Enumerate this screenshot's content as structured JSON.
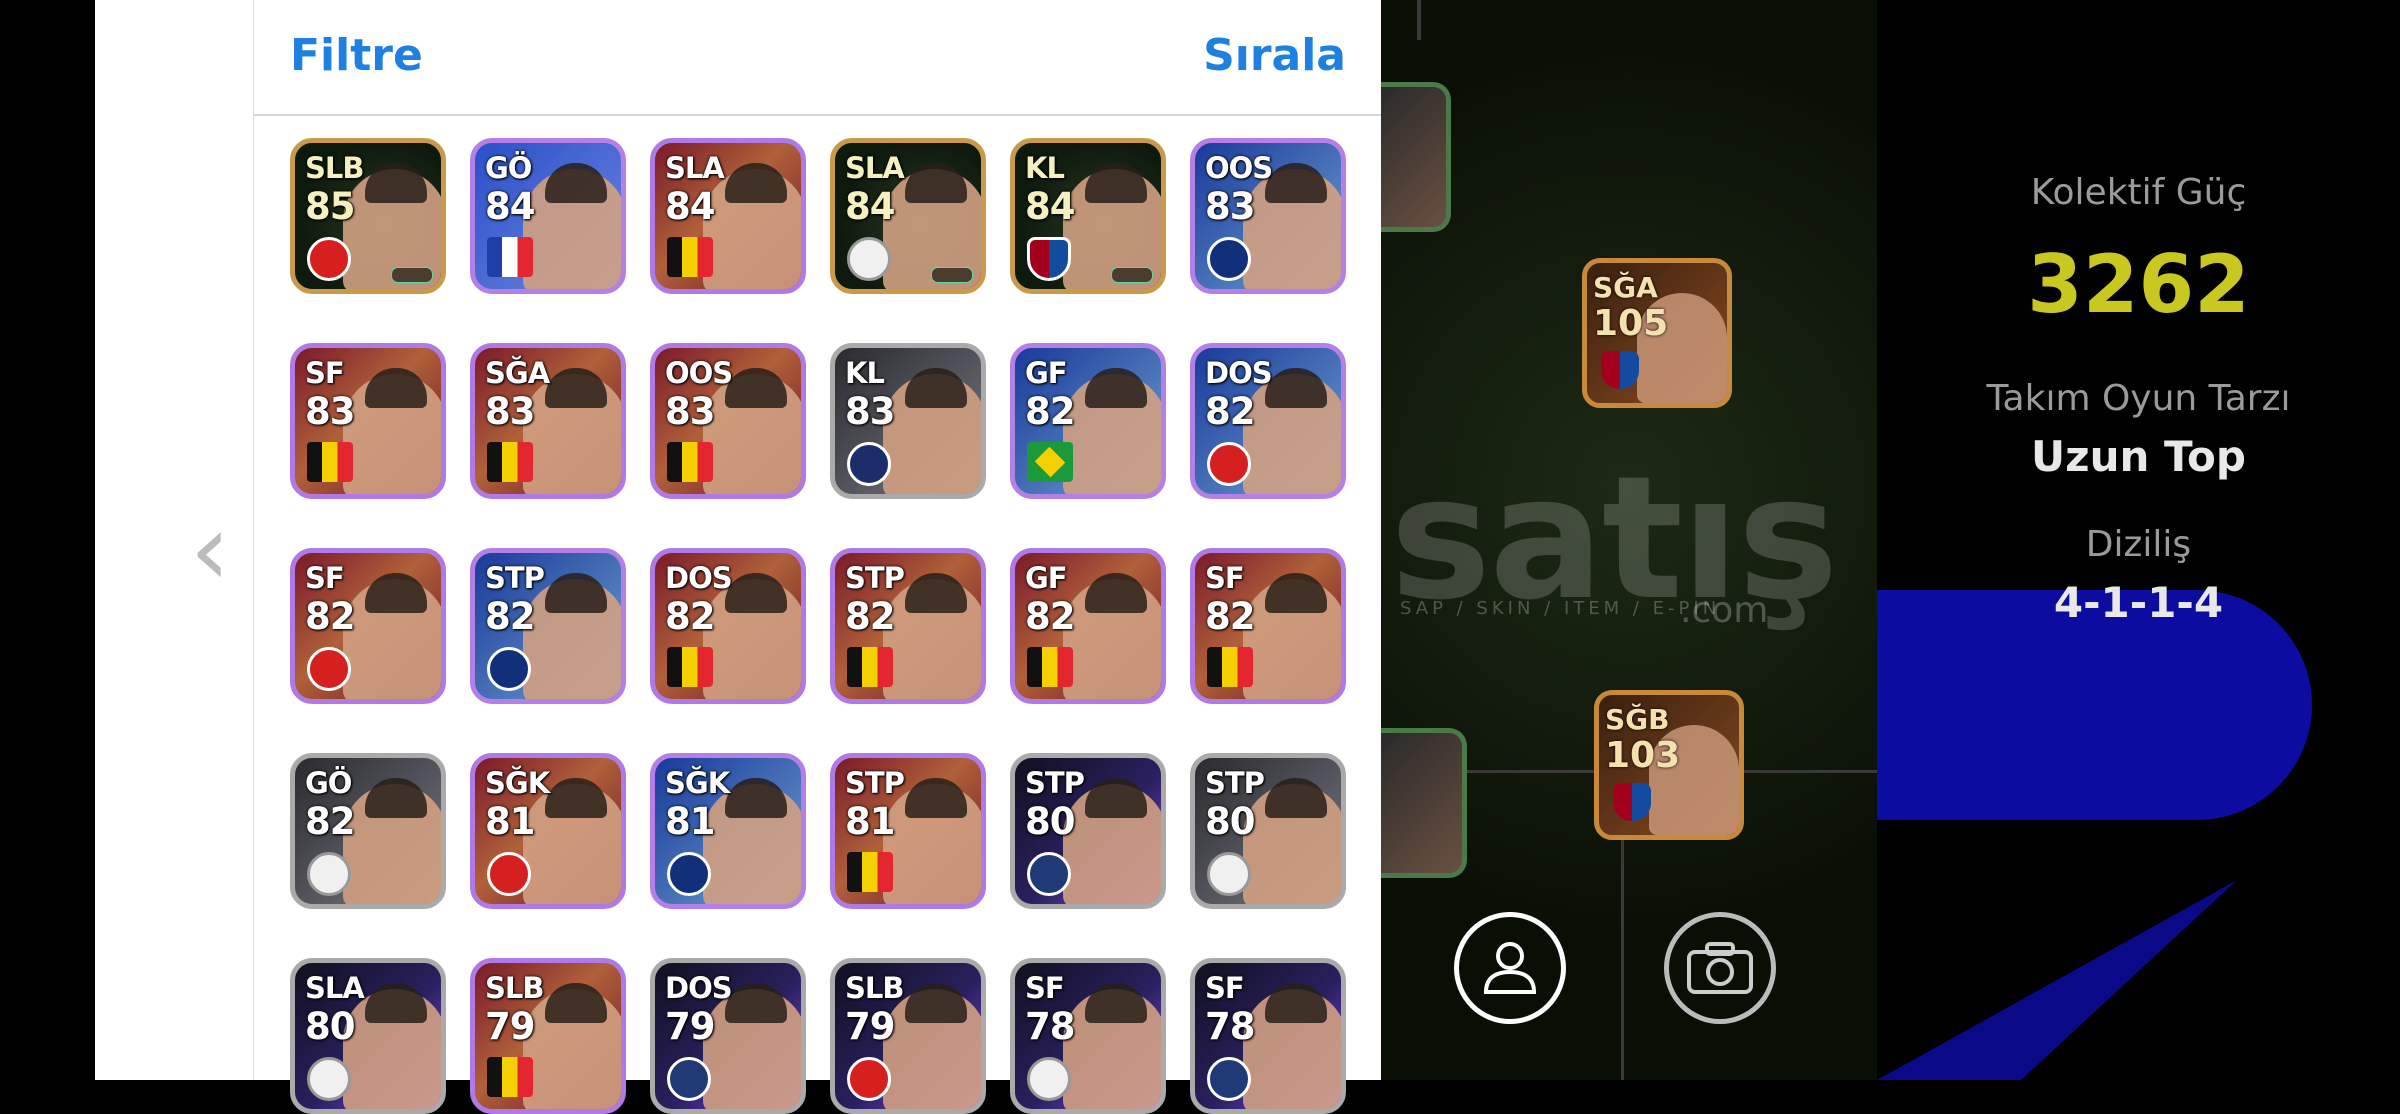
{
  "panel": {
    "filter_label": "Filtre",
    "sort_label": "Sırala"
  },
  "players": [
    {
      "pos": "SLB",
      "rating": "85",
      "style": "green",
      "badge": "club mu"
    },
    {
      "pos": "GÖ",
      "rating": "84",
      "style": "blue",
      "badge": "flag-fr"
    },
    {
      "pos": "SLA",
      "rating": "84",
      "style": "maroon",
      "badge": "flag-be"
    },
    {
      "pos": "SLA",
      "rating": "84",
      "style": "green",
      "badge": "club white"
    },
    {
      "pos": "KL",
      "rating": "84",
      "style": "green",
      "badge": "club fcb"
    },
    {
      "pos": "OOS",
      "rating": "83",
      "style": "inter",
      "badge": "club inter"
    },
    {
      "pos": "SF",
      "rating": "83",
      "style": "maroon",
      "badge": "flag-be"
    },
    {
      "pos": "SĞA",
      "rating": "83",
      "style": "maroon",
      "badge": "flag-be"
    },
    {
      "pos": "OOS",
      "rating": "83",
      "style": "maroon",
      "badge": "flag-be"
    },
    {
      "pos": "KL",
      "rating": "83",
      "style": "gray",
      "badge": "club psg"
    },
    {
      "pos": "GF",
      "rating": "82",
      "style": "inter",
      "badge": "flag-br"
    },
    {
      "pos": "DOS",
      "rating": "82",
      "style": "inter",
      "badge": "club mu"
    },
    {
      "pos": "SF",
      "rating": "82",
      "style": "maroon",
      "badge": "club mu"
    },
    {
      "pos": "STP",
      "rating": "82",
      "style": "inter",
      "badge": "club inter"
    },
    {
      "pos": "DOS",
      "rating": "82",
      "style": "maroon",
      "badge": "flag-be"
    },
    {
      "pos": "STP",
      "rating": "82",
      "style": "maroon",
      "badge": "flag-be"
    },
    {
      "pos": "GF",
      "rating": "82",
      "style": "maroon",
      "badge": "flag-be"
    },
    {
      "pos": "SF",
      "rating": "82",
      "style": "maroon",
      "badge": "flag-be"
    },
    {
      "pos": "GÖ",
      "rating": "82",
      "style": "gray",
      "badge": "club white"
    },
    {
      "pos": "SĞK",
      "rating": "81",
      "style": "maroon",
      "badge": "club mu"
    },
    {
      "pos": "SĞK",
      "rating": "81",
      "style": "inter",
      "badge": "club inter"
    },
    {
      "pos": "STP",
      "rating": "81",
      "style": "maroon",
      "badge": "flag-be"
    },
    {
      "pos": "STP",
      "rating": "80",
      "style": "purple",
      "badge": "club navy"
    },
    {
      "pos": "STP",
      "rating": "80",
      "style": "gray",
      "badge": "club white"
    },
    {
      "pos": "SLA",
      "rating": "80",
      "style": "purple",
      "badge": "club white"
    },
    {
      "pos": "SLB",
      "rating": "79",
      "style": "maroon",
      "badge": "flag-be"
    },
    {
      "pos": "DOS",
      "rating": "79",
      "style": "purple",
      "badge": "club navy"
    },
    {
      "pos": "SLB",
      "rating": "79",
      "style": "purple",
      "badge": "club mu"
    },
    {
      "pos": "SF",
      "rating": "78",
      "style": "purple",
      "badge": "club white"
    },
    {
      "pos": "SF",
      "rating": "78",
      "style": "purple",
      "badge": "club navy"
    }
  ],
  "field_players": [
    {
      "pos": "SĞA",
      "rating": "105"
    },
    {
      "pos": "SĞB",
      "rating": "103"
    }
  ],
  "watermark": {
    "main": "satış",
    "sub": "SAP / SKIN / ITEM / E-PIN",
    "com": ".com"
  },
  "stats": {
    "collective_label": "Kolektif Güç",
    "collective_value": "3262",
    "style_label": "Takım Oyun Tarzı",
    "style_value": "Uzun Top",
    "formation_label": "Diziliş",
    "formation_value": "4-1-1-4"
  },
  "colors": {
    "accent": "#1e80e0",
    "collective": "#c8c820"
  },
  "icons": {
    "prev": "chevron-left-icon",
    "profile": "person-icon",
    "camera": "camera-icon"
  }
}
